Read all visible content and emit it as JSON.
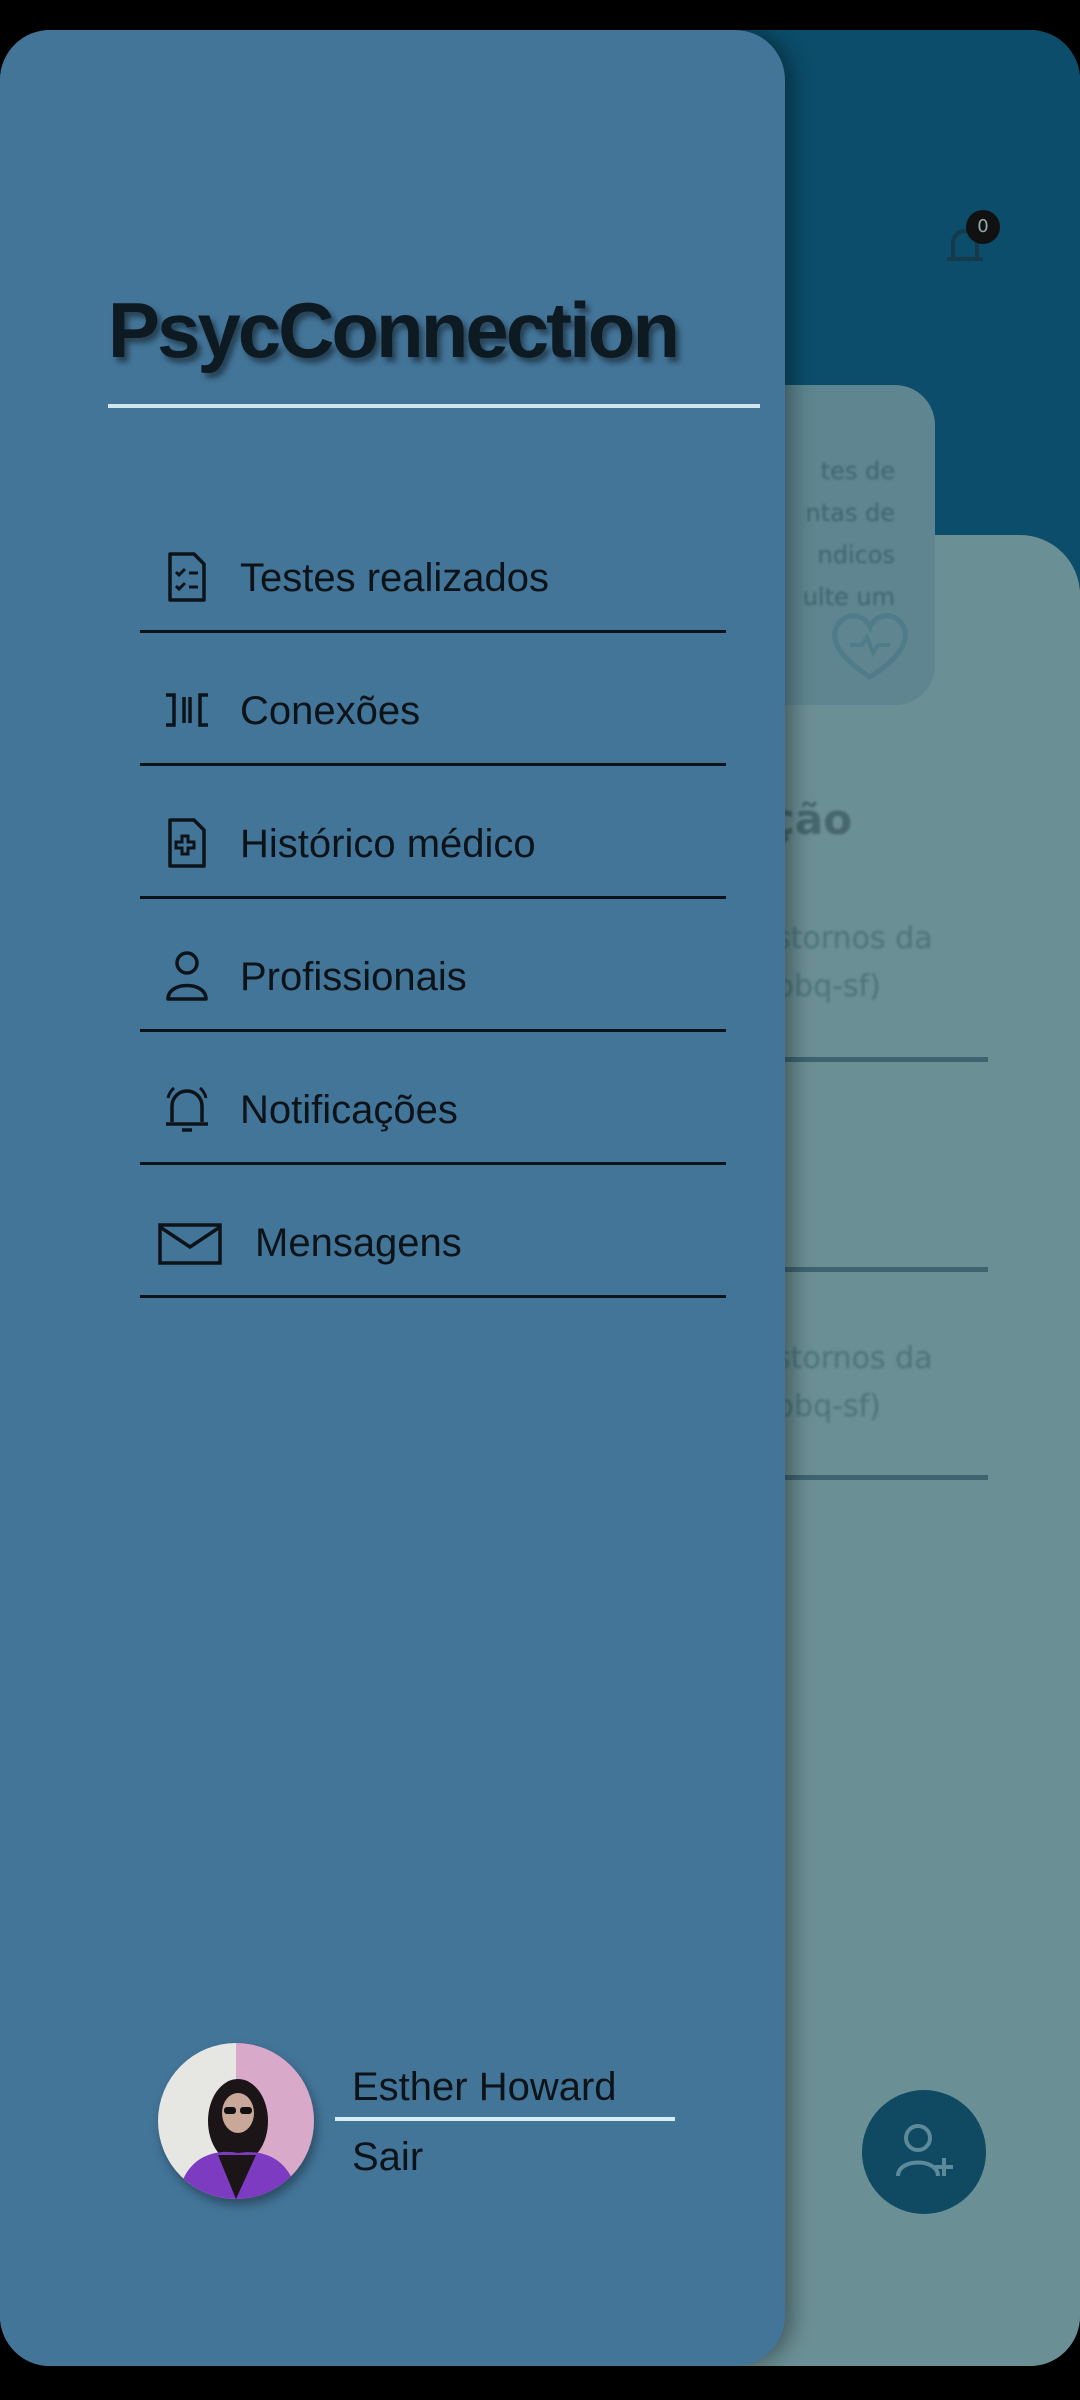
{
  "background": {
    "notification_count": "0",
    "card_text": [
      "tes de",
      "ntas de",
      "ndicos",
      "ulte um"
    ],
    "section_title": "ção",
    "rows": [
      {
        "line1": "stornos da",
        "line2": "pbq-sf)"
      },
      {
        "line1": "stornos da",
        "line2": "pbq-sf)"
      }
    ]
  },
  "drawer": {
    "app_title": "PsycConnection",
    "menu": [
      {
        "label": "Testes realizados",
        "icon": "checklist-document-icon"
      },
      {
        "label": "Conexões",
        "icon": "connections-icon"
      },
      {
        "label": "Histórico médico",
        "icon": "medical-file-icon"
      },
      {
        "label": "Profissionais",
        "icon": "person-icon"
      },
      {
        "label": "Notificações",
        "icon": "bell-icon"
      },
      {
        "label": "Mensagens",
        "icon": "envelope-icon"
      }
    ],
    "user": {
      "name": "Esther Howard",
      "logout_label": "Sair"
    }
  },
  "colors": {
    "drawer_bg": "#437599",
    "header_bg": "#0b4d6a",
    "content_bg": "#6a8f94",
    "text": "#0d1419"
  }
}
